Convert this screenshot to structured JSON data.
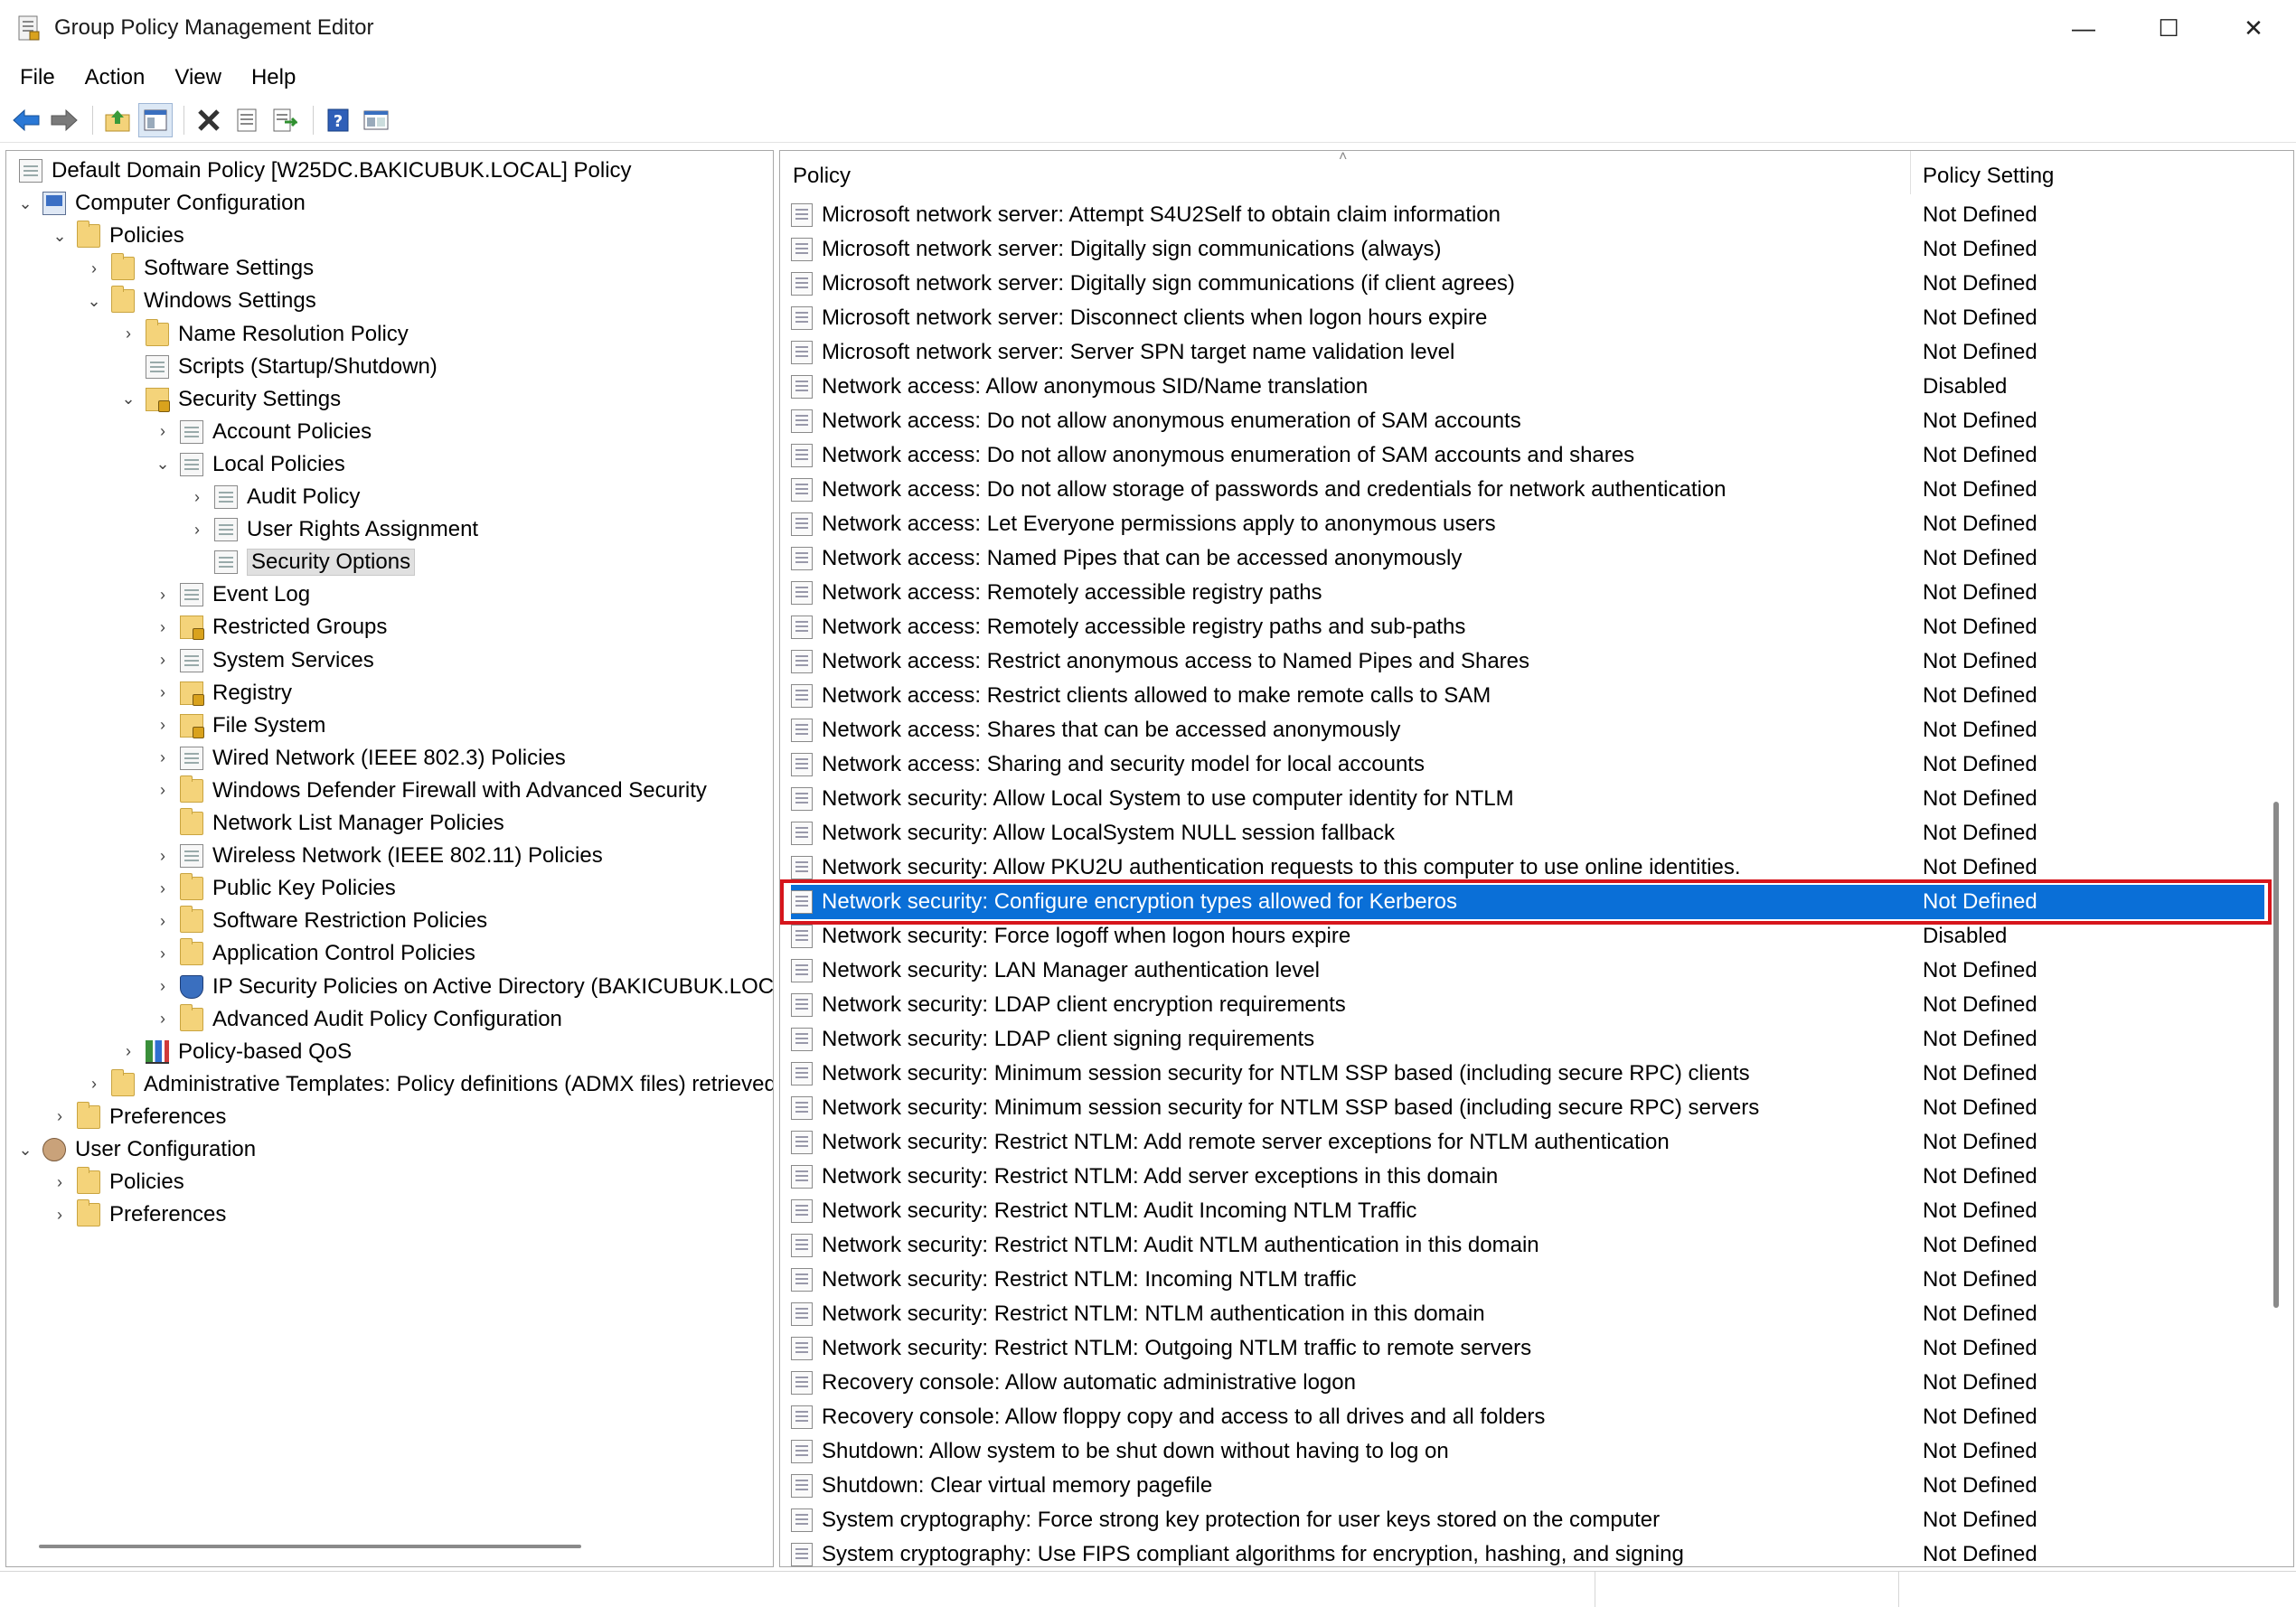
{
  "window": {
    "title": "Group Policy Management Editor",
    "controls": {
      "minimize": "—",
      "maximize": "☐",
      "close": "✕"
    }
  },
  "menu": [
    "File",
    "Action",
    "View",
    "Help"
  ],
  "toolbar": [
    "back-arrow-icon",
    "forward-arrow-icon",
    "up-folder-icon",
    "show-hide-tree-icon",
    "delete-icon",
    "properties-icon",
    "export-list-icon",
    "help-icon",
    "console-view-icon"
  ],
  "tree": {
    "root": "Default Domain Policy [W25DC.BAKICUBUK.LOCAL] Policy",
    "items": [
      {
        "label": "Computer Configuration",
        "level": 0,
        "twisty": "open",
        "icon": "computer"
      },
      {
        "label": "Policies",
        "level": 1,
        "twisty": "open",
        "icon": "folder"
      },
      {
        "label": "Software Settings",
        "level": 2,
        "twisty": "closed",
        "icon": "folder"
      },
      {
        "label": "Windows Settings",
        "level": 2,
        "twisty": "open",
        "icon": "folder"
      },
      {
        "label": "Name Resolution Policy",
        "level": 3,
        "twisty": "closed",
        "icon": "folder"
      },
      {
        "label": "Scripts (Startup/Shutdown)",
        "level": 3,
        "twisty": "none",
        "icon": "doc"
      },
      {
        "label": "Security Settings",
        "level": 3,
        "twisty": "open",
        "icon": "lockfolder"
      },
      {
        "label": "Account Policies",
        "level": 4,
        "twisty": "closed",
        "icon": "doc"
      },
      {
        "label": "Local Policies",
        "level": 4,
        "twisty": "open",
        "icon": "doc"
      },
      {
        "label": "Audit Policy",
        "level": 5,
        "twisty": "closed",
        "icon": "doc"
      },
      {
        "label": "User Rights Assignment",
        "level": 5,
        "twisty": "closed",
        "icon": "doc"
      },
      {
        "label": "Security Options",
        "level": 5,
        "twisty": "none",
        "icon": "doc",
        "selected": true
      },
      {
        "label": "Event Log",
        "level": 4,
        "twisty": "closed",
        "icon": "doc"
      },
      {
        "label": "Restricted Groups",
        "level": 4,
        "twisty": "closed",
        "icon": "lockfolder"
      },
      {
        "label": "System Services",
        "level": 4,
        "twisty": "closed",
        "icon": "doc"
      },
      {
        "label": "Registry",
        "level": 4,
        "twisty": "closed",
        "icon": "lockfolder"
      },
      {
        "label": "File System",
        "level": 4,
        "twisty": "closed",
        "icon": "lockfolder"
      },
      {
        "label": "Wired Network (IEEE 802.3) Policies",
        "level": 4,
        "twisty": "closed",
        "icon": "doc"
      },
      {
        "label": "Windows Defender Firewall with Advanced Security",
        "level": 4,
        "twisty": "closed",
        "icon": "folder"
      },
      {
        "label": "Network List Manager Policies",
        "level": 4,
        "twisty": "none",
        "icon": "folder"
      },
      {
        "label": "Wireless Network (IEEE 802.11) Policies",
        "level": 4,
        "twisty": "closed",
        "icon": "doc"
      },
      {
        "label": "Public Key Policies",
        "level": 4,
        "twisty": "closed",
        "icon": "folder"
      },
      {
        "label": "Software Restriction Policies",
        "level": 4,
        "twisty": "closed",
        "icon": "folder"
      },
      {
        "label": "Application Control Policies",
        "level": 4,
        "twisty": "closed",
        "icon": "folder"
      },
      {
        "label": "IP Security Policies on Active Directory (BAKICUBUK.LOCAL)",
        "level": 4,
        "twisty": "closed",
        "icon": "shield"
      },
      {
        "label": "Advanced Audit Policy Configuration",
        "level": 4,
        "twisty": "closed",
        "icon": "folder"
      },
      {
        "label": "Policy-based QoS",
        "level": 3,
        "twisty": "closed",
        "icon": "chart"
      },
      {
        "label": "Administrative Templates: Policy definitions (ADMX files) retrieved",
        "level": 2,
        "twisty": "closed",
        "icon": "folder"
      },
      {
        "label": "Preferences",
        "level": 1,
        "twisty": "closed",
        "icon": "folder"
      },
      {
        "label": "User Configuration",
        "level": 0,
        "twisty": "open",
        "icon": "user"
      },
      {
        "label": "Policies",
        "level": 1,
        "twisty": "closed",
        "icon": "folder"
      },
      {
        "label": "Preferences",
        "level": 1,
        "twisty": "closed",
        "icon": "folder"
      }
    ]
  },
  "list": {
    "headers": {
      "policy": "Policy",
      "setting": "Policy Setting"
    },
    "rows": [
      {
        "policy": "Microsoft network server: Attempt S4U2Self to obtain claim information",
        "setting": "Not Defined"
      },
      {
        "policy": "Microsoft network server: Digitally sign communications (always)",
        "setting": "Not Defined"
      },
      {
        "policy": "Microsoft network server: Digitally sign communications (if client agrees)",
        "setting": "Not Defined"
      },
      {
        "policy": "Microsoft network server: Disconnect clients when logon hours expire",
        "setting": "Not Defined"
      },
      {
        "policy": "Microsoft network server: Server SPN target name validation level",
        "setting": "Not Defined"
      },
      {
        "policy": "Network access: Allow anonymous SID/Name translation",
        "setting": "Disabled"
      },
      {
        "policy": "Network access: Do not allow anonymous enumeration of SAM accounts",
        "setting": "Not Defined"
      },
      {
        "policy": "Network access: Do not allow anonymous enumeration of SAM accounts and shares",
        "setting": "Not Defined"
      },
      {
        "policy": "Network access: Do not allow storage of passwords and credentials for network authentication",
        "setting": "Not Defined"
      },
      {
        "policy": "Network access: Let Everyone permissions apply to anonymous users",
        "setting": "Not Defined"
      },
      {
        "policy": "Network access: Named Pipes that can be accessed anonymously",
        "setting": "Not Defined"
      },
      {
        "policy": "Network access: Remotely accessible registry paths",
        "setting": "Not Defined"
      },
      {
        "policy": "Network access: Remotely accessible registry paths and sub-paths",
        "setting": "Not Defined"
      },
      {
        "policy": "Network access: Restrict anonymous access to Named Pipes and Shares",
        "setting": "Not Defined"
      },
      {
        "policy": "Network access: Restrict clients allowed to make remote calls to SAM",
        "setting": "Not Defined"
      },
      {
        "policy": "Network access: Shares that can be accessed anonymously",
        "setting": "Not Defined"
      },
      {
        "policy": "Network access: Sharing and security model for local accounts",
        "setting": "Not Defined"
      },
      {
        "policy": "Network security: Allow Local System to use computer identity for NTLM",
        "setting": "Not Defined"
      },
      {
        "policy": "Network security: Allow LocalSystem NULL session fallback",
        "setting": "Not Defined"
      },
      {
        "policy": "Network security: Allow PKU2U authentication requests to this computer to use online identities.",
        "setting": "Not Defined"
      },
      {
        "policy": "Network security: Configure encryption types allowed for Kerberos",
        "setting": "Not Defined",
        "selected": true
      },
      {
        "policy": "Network security: Force logoff when logon hours expire",
        "setting": "Disabled"
      },
      {
        "policy": "Network security: LAN Manager authentication level",
        "setting": "Not Defined"
      },
      {
        "policy": "Network security: LDAP client encryption requirements",
        "setting": "Not Defined"
      },
      {
        "policy": "Network security: LDAP client signing requirements",
        "setting": "Not Defined"
      },
      {
        "policy": "Network security: Minimum session security for NTLM SSP based (including secure RPC) clients",
        "setting": "Not Defined"
      },
      {
        "policy": "Network security: Minimum session security for NTLM SSP based (including secure RPC) servers",
        "setting": "Not Defined"
      },
      {
        "policy": "Network security: Restrict NTLM: Add remote server exceptions for NTLM authentication",
        "setting": "Not Defined"
      },
      {
        "policy": "Network security: Restrict NTLM: Add server exceptions in this domain",
        "setting": "Not Defined"
      },
      {
        "policy": "Network security: Restrict NTLM: Audit Incoming NTLM Traffic",
        "setting": "Not Defined"
      },
      {
        "policy": "Network security: Restrict NTLM: Audit NTLM authentication in this domain",
        "setting": "Not Defined"
      },
      {
        "policy": "Network security: Restrict NTLM: Incoming NTLM traffic",
        "setting": "Not Defined"
      },
      {
        "policy": "Network security: Restrict NTLM: NTLM authentication in this domain",
        "setting": "Not Defined"
      },
      {
        "policy": "Network security: Restrict NTLM: Outgoing NTLM traffic to remote servers",
        "setting": "Not Defined"
      },
      {
        "policy": "Recovery console: Allow automatic administrative logon",
        "setting": "Not Defined"
      },
      {
        "policy": "Recovery console: Allow floppy copy and access to all drives and all folders",
        "setting": "Not Defined"
      },
      {
        "policy": "Shutdown: Allow system to be shut down without having to log on",
        "setting": "Not Defined"
      },
      {
        "policy": "Shutdown: Clear virtual memory pagefile",
        "setting": "Not Defined"
      },
      {
        "policy": "System cryptography: Force strong key protection for user keys stored on the computer",
        "setting": "Not Defined"
      },
      {
        "policy": "System cryptography: Use FIPS compliant algorithms for encryption, hashing, and signing",
        "setting": "Not Defined"
      }
    ]
  },
  "colors": {
    "selection": "#0a6fd7",
    "highlight_border": "#d6151c"
  }
}
